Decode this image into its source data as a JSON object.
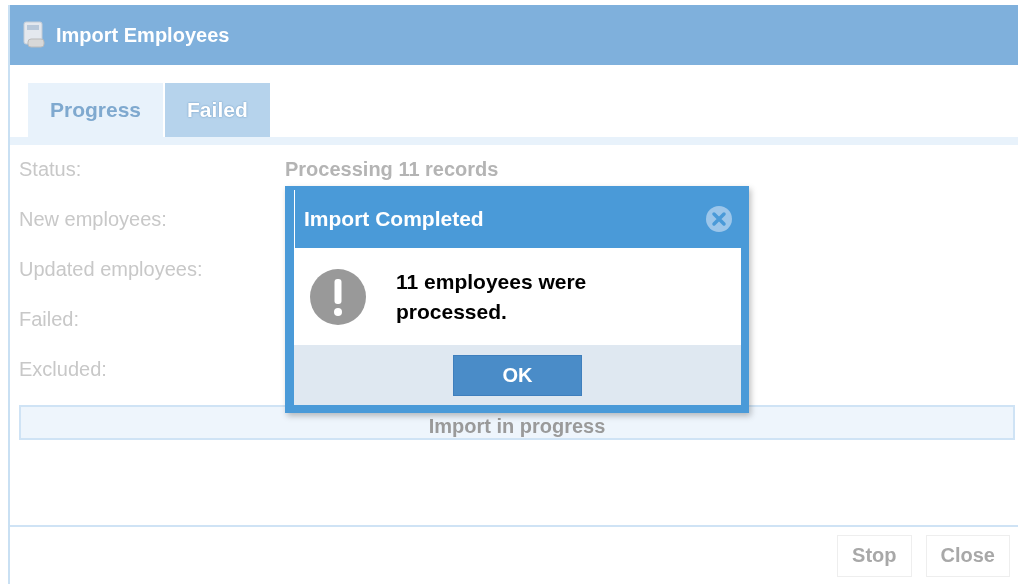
{
  "window": {
    "title": "Import Employees"
  },
  "tabs": [
    {
      "label": "Progress",
      "selected": true
    },
    {
      "label": "Failed",
      "selected": false
    }
  ],
  "fields": [
    {
      "label": "Status:",
      "value": "Processing 11 records"
    },
    {
      "label": "New employees:"
    },
    {
      "label": "Updated employees:"
    },
    {
      "label": "Failed:"
    },
    {
      "label": "Excluded:"
    }
  ],
  "progress": {
    "text": "Import in progress",
    "level": 1
  },
  "buttons": [
    {
      "label": "Stop",
      "disabled": true
    },
    {
      "label": "Close",
      "disabled": true
    }
  ],
  "dialog": {
    "title": "Import Completed",
    "message": "11 employees were processed.",
    "button": "OK"
  }
}
